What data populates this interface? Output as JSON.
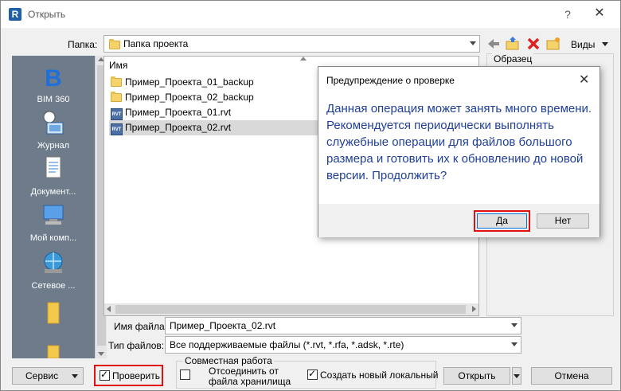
{
  "window": {
    "title": "Открыть",
    "help": "?",
    "close": "✕"
  },
  "folder": {
    "label": "Папка:",
    "value": "Папка проекта",
    "views_label": "Виды"
  },
  "sidebar": {
    "items": [
      "BIM 360",
      "Журнал",
      "Документ...",
      "Мой комп...",
      "Сетевое ..."
    ]
  },
  "filelist": {
    "column": "Имя",
    "files": [
      {
        "name": "Пример_Проекта_01_backup",
        "type": "folder"
      },
      {
        "name": "Пример_Проекта_02_backup",
        "type": "folder"
      },
      {
        "name": "Пример_Проекта_01.rvt",
        "type": "rvt"
      },
      {
        "name": "Пример_Проекта_02.rvt",
        "type": "rvt",
        "selected": true
      }
    ]
  },
  "preview": {
    "label": "Образец"
  },
  "filename": {
    "label": "Имя файла:",
    "value": "Пример_Проекта_02.rvt"
  },
  "filetype": {
    "label": "Тип файлов:",
    "value": "Все поддерживаемые файлы  (*.rvt, *.rfa, *.adsk, *.rte)"
  },
  "bottom": {
    "service": "Сервис",
    "verify": "Проверить",
    "group_title": "Совместная работа",
    "detach_line1": "Отсоединить от",
    "detach_line2": "файла хранилища",
    "create_local": "Создать новый локальный",
    "open": "Открыть",
    "cancel": "Отмена"
  },
  "modal": {
    "title": "Предупреждение о проверке",
    "close": "✕",
    "message": "Данная операция может занять много времени. Рекомендуется периодически выполнять служебные операции для файлов большого размера и готовить их к обновлению до новой версии. Продолжить?",
    "yes": "Да",
    "no": "Нет"
  },
  "colors": {
    "accent_text": "#1f3f9a",
    "highlight": "#e01010",
    "sidebar_bg": "#6e7b8b"
  }
}
